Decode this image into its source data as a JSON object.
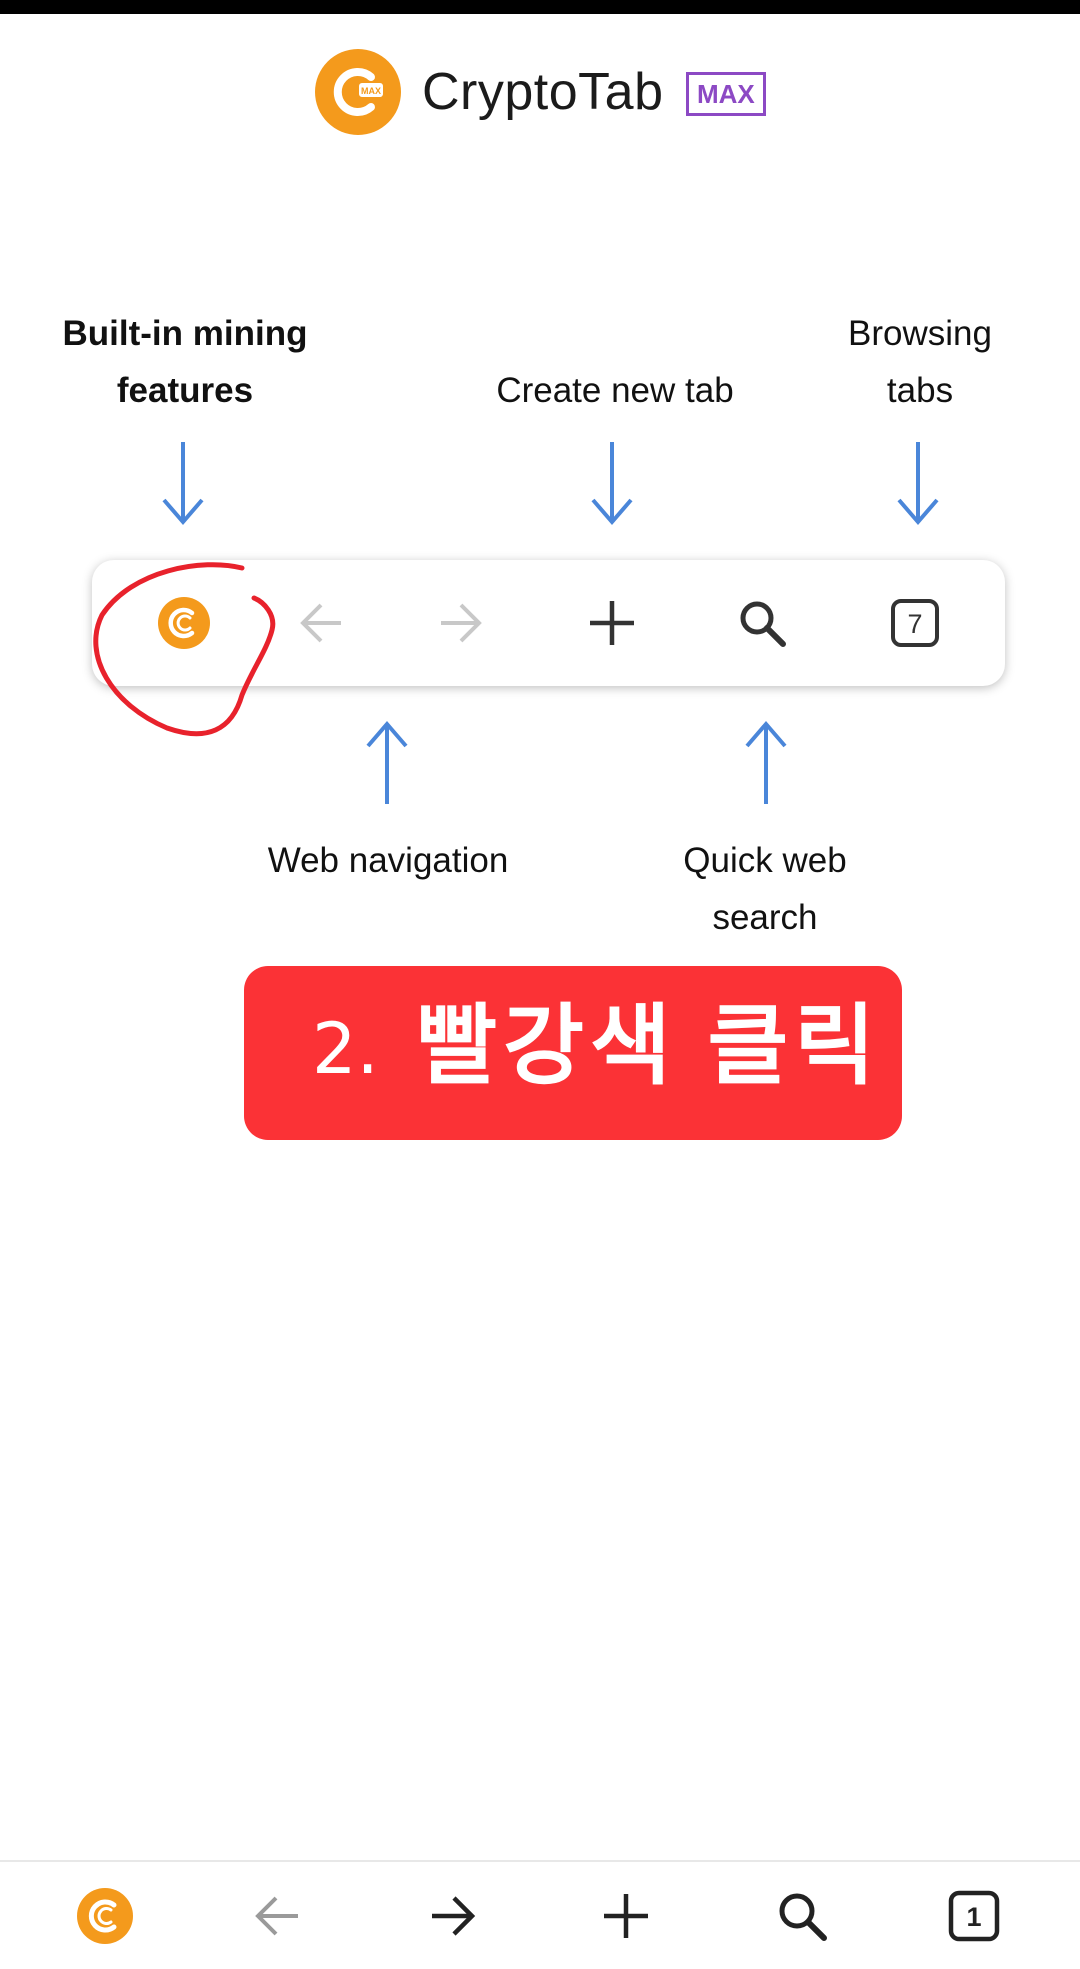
{
  "brand": {
    "name": "CryptoTab",
    "badge": "MAX",
    "badge_color": "#8c49c4",
    "logo_color": "#f49a1c"
  },
  "labels": {
    "mining_line1": "Built-in mining",
    "mining_line2": "features",
    "new_tab": "Create new tab",
    "browsing_line1": "Browsing",
    "browsing_line2": "tabs",
    "web_navigation": "Web navigation",
    "quick_search_line1": "Quick web",
    "quick_search_line2": "search"
  },
  "toolbar_demo": {
    "icons": [
      "cryptotab-logo-icon",
      "back-arrow-icon",
      "forward-arrow-icon",
      "plus-icon",
      "search-icon",
      "tabs-counter-icon"
    ],
    "tab_count": "7"
  },
  "callout": {
    "number": "2.",
    "text": "빨강색 클릭",
    "color": "#fb3236"
  },
  "bottom_nav": {
    "icons": [
      "cryptotab-logo-icon",
      "back-arrow-icon",
      "forward-arrow-icon",
      "plus-icon",
      "search-icon",
      "tabs-counter-icon"
    ],
    "tab_count": "1"
  },
  "colors": {
    "arrow_blue": "#4a86d9",
    "annotation_red": "#e8222c"
  }
}
